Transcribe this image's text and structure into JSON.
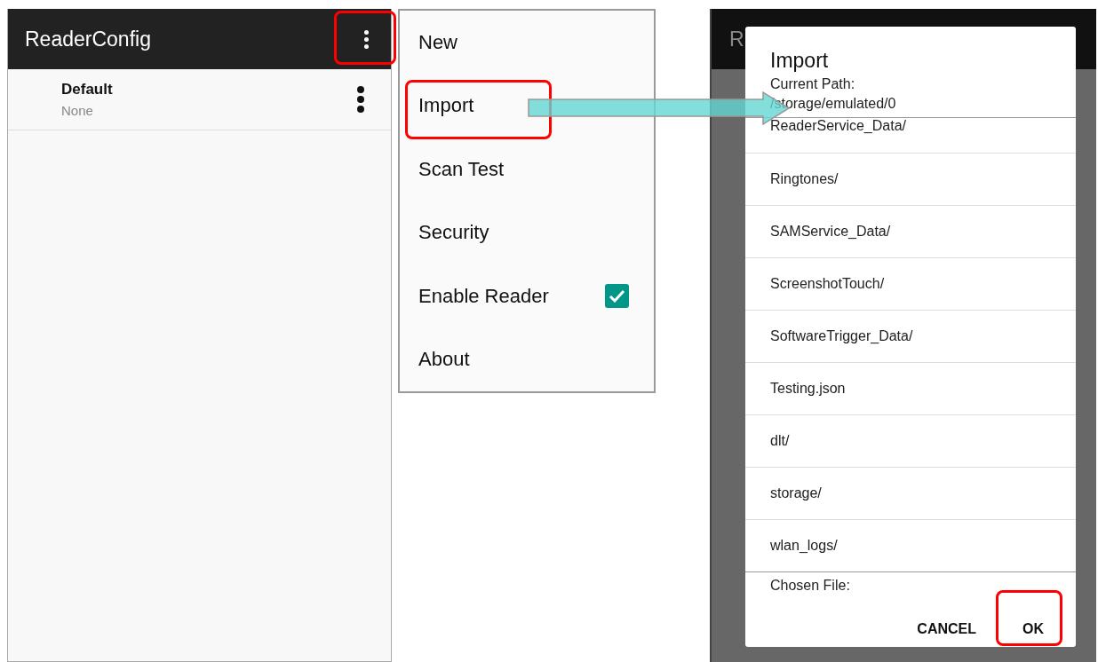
{
  "app": {
    "title": "ReaderConfig",
    "profiles": [
      {
        "name": "Default",
        "value": "None"
      }
    ]
  },
  "overflow_menu": {
    "items": [
      {
        "label": "New",
        "kind": "plain"
      },
      {
        "label": "Import",
        "kind": "plain"
      },
      {
        "label": "Scan Test",
        "kind": "plain"
      },
      {
        "label": "Security",
        "kind": "plain"
      },
      {
        "label": "Enable Reader",
        "kind": "checkbox",
        "checked": true
      },
      {
        "label": "About",
        "kind": "plain"
      }
    ]
  },
  "import_dialog": {
    "background_title": "R",
    "title": "Import",
    "path_label": "Current Path:",
    "path": "/storage/emulated/0",
    "entries": [
      "ReaderService_Data/",
      "Ringtones/",
      "SAMService_Data/",
      "ScreenshotTouch/",
      "SoftwareTrigger_Data/",
      "Testing.json",
      "dlt/",
      "storage/",
      "wlan_logs/"
    ],
    "chosen_file_label": "Chosen File:",
    "buttons": [
      "CANCEL",
      "OK"
    ]
  }
}
